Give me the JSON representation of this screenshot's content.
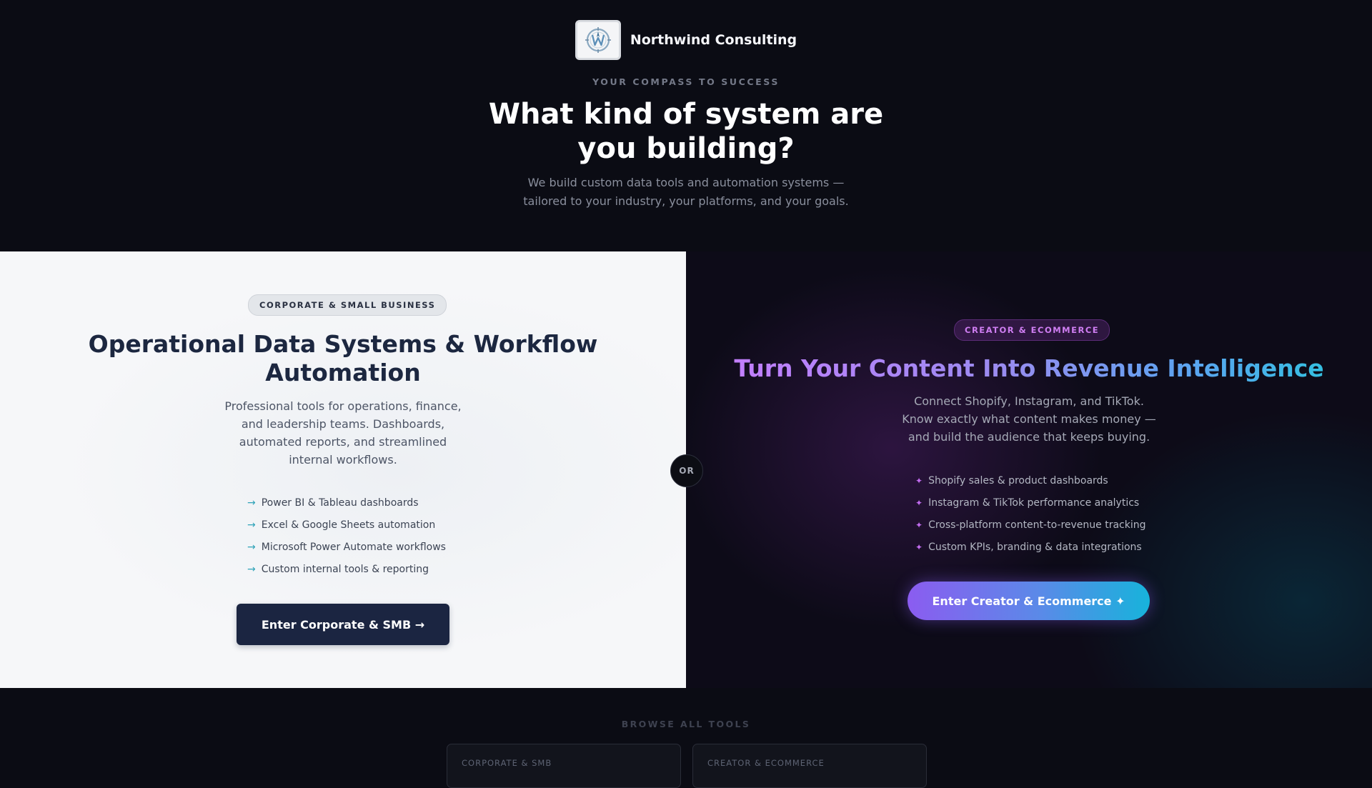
{
  "brand": {
    "name": "Northwind Consulting",
    "logo_icon": "compass-w-logo-icon"
  },
  "hero": {
    "eyebrow": "YOUR COMPASS TO SUCCESS",
    "title": "What kind of system are you building?",
    "subtitle": "We build custom data tools and automation systems — tailored to your industry, your platforms, and your goals."
  },
  "corporate": {
    "badge": "CORPORATE & SMALL BUSINESS",
    "title": "Operational Data Systems & Workflow Automation",
    "description": "Professional tools for operations, finance, and leadership teams. Dashboards, automated reports, and streamlined internal workflows.",
    "bullet_icon": "arrow-right-icon",
    "items": [
      "Power BI & Tableau dashboards",
      "Excel & Google Sheets automation",
      "Microsoft Power Automate workflows",
      "Custom internal tools & reporting"
    ],
    "button_label": "Enter Corporate & SMB →"
  },
  "divider": {
    "label": "OR"
  },
  "creator": {
    "badge": "CREATOR & ECOMMERCE",
    "title": "Turn Your Content Into Revenue Intelligence",
    "description": "Connect Shopify, Instagram, and TikTok. Know exactly what content makes money — and build the audience that keeps buying.",
    "bullet_icon": "sparkle-icon",
    "items": [
      "Shopify sales & product dashboards",
      "Instagram & TikTok performance analytics",
      "Cross-platform content-to-revenue tracking",
      "Custom KPIs, branding & data integrations"
    ],
    "button_label": "Enter Creator & Ecommerce ✦"
  },
  "browse": {
    "label": "BROWSE ALL TOOLS",
    "cards": [
      {
        "label": "CORPORATE & SMB"
      },
      {
        "label": "CREATOR & ECOMMERCE"
      }
    ]
  },
  "colors": {
    "background": "#0b0c14",
    "corporate_button": "#1b2541",
    "creator_gradient_start": "#8b5cf0",
    "creator_gradient_end": "#17b3db",
    "creator_badge_text": "#cf7ef2"
  }
}
